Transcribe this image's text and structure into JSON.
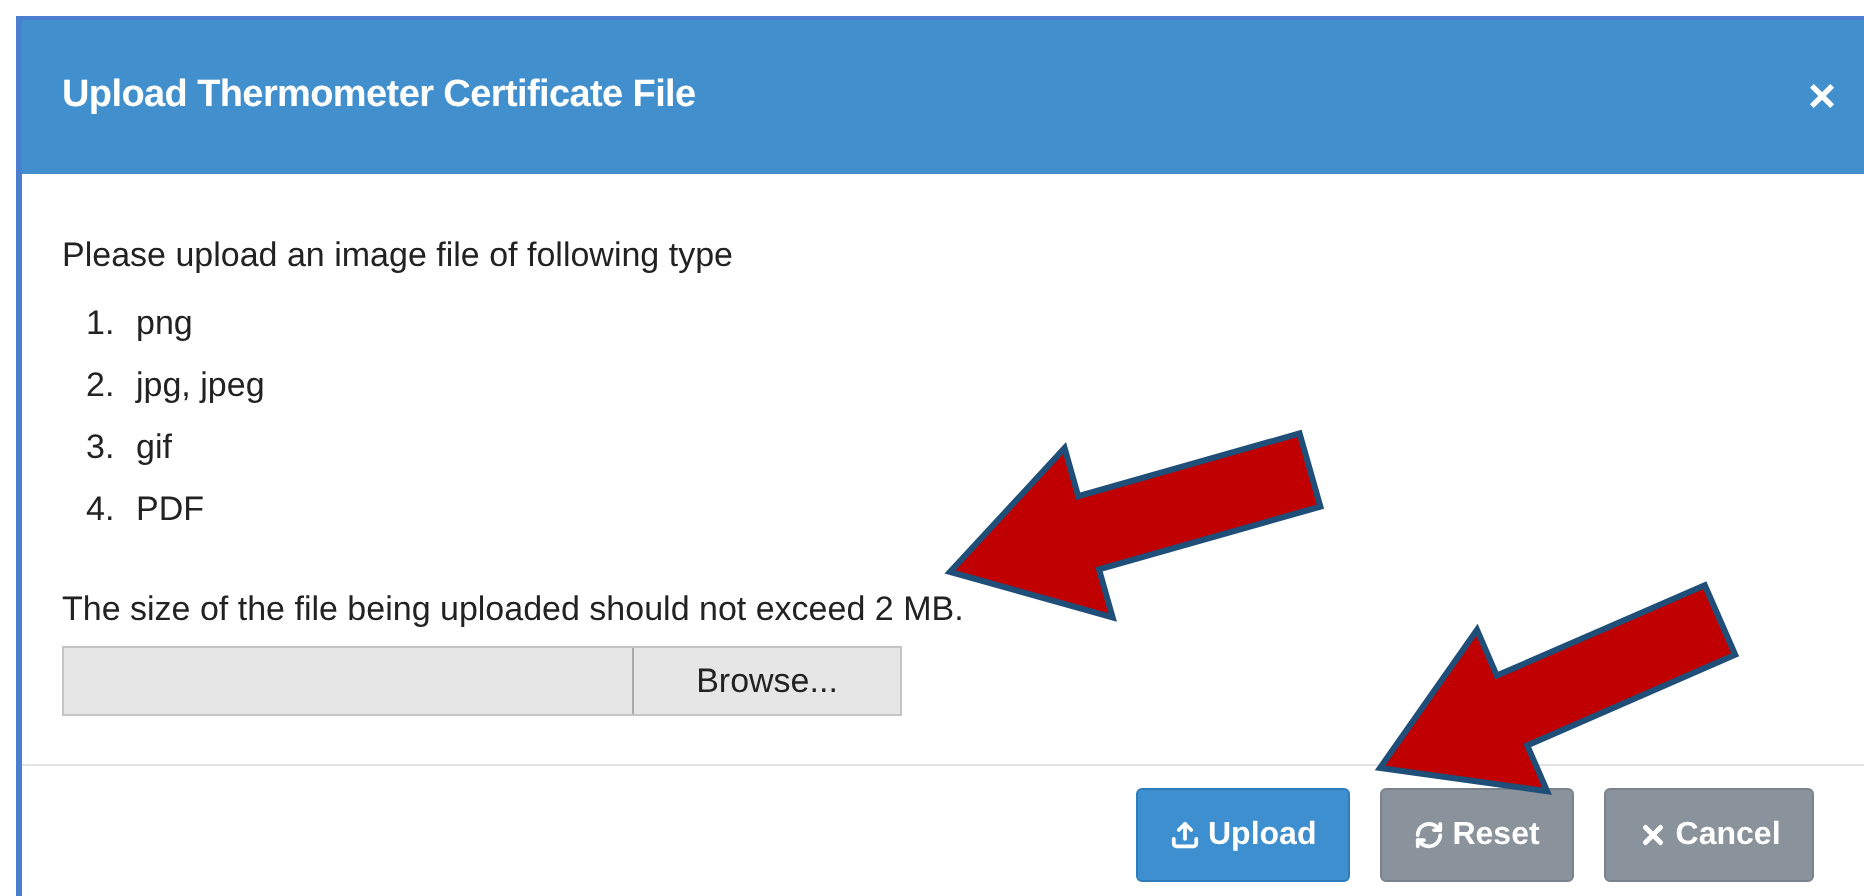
{
  "dialog": {
    "title": "Upload Thermometer Certificate File",
    "close": "×"
  },
  "intro": "Please upload an image file of following type",
  "file_types": [
    {
      "number": "1.",
      "label": "png"
    },
    {
      "number": "2.",
      "label": "jpg, jpeg"
    },
    {
      "number": "3.",
      "label": "gif"
    },
    {
      "number": "4.",
      "label": "PDF"
    }
  ],
  "size_note": "The size of the file being uploaded should not exceed 2 MB.",
  "browse_label": "Browse...",
  "buttons": [
    {
      "kind": "upload",
      "label": "Upload"
    },
    {
      "kind": "reset",
      "label": "Reset"
    },
    {
      "kind": "cancel",
      "label": "Cancel"
    }
  ]
}
